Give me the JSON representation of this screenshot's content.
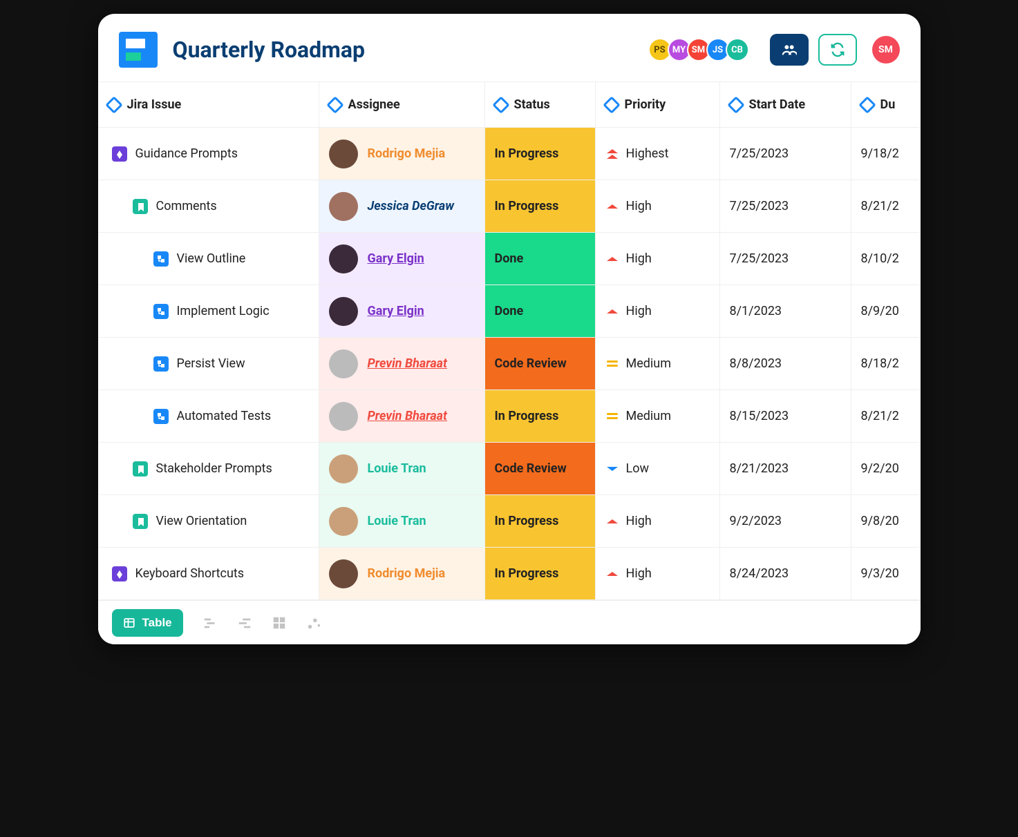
{
  "title": "Quarterly Roadmap",
  "presence": [
    "PS",
    "MY",
    "SM",
    "JS",
    "CB"
  ],
  "currentUser": "SM",
  "columns": {
    "issue": "Jira Issue",
    "assignee": "Assignee",
    "status": "Status",
    "priority": "Priority",
    "start": "Start Date",
    "due": "Du"
  },
  "footer": {
    "activeView": "Table"
  },
  "rows": [
    {
      "indent": 0,
      "type": "epic",
      "issue": "Guidance Prompts",
      "assignee": {
        "key": "rm",
        "name": "Rodrigo Mejia"
      },
      "status": {
        "key": "progress",
        "label": "In Progress"
      },
      "priority": {
        "key": "highest",
        "label": "Highest"
      },
      "start": "7/25/2023",
      "due": "9/18/2"
    },
    {
      "indent": 1,
      "type": "story",
      "issue": "Comments",
      "assignee": {
        "key": "jd",
        "name": "Jessica DeGraw"
      },
      "status": {
        "key": "progress",
        "label": "In Progress"
      },
      "priority": {
        "key": "high",
        "label": "High"
      },
      "start": "7/25/2023",
      "due": "8/21/2"
    },
    {
      "indent": 2,
      "type": "subtask",
      "issue": "View Outline",
      "assignee": {
        "key": "ge",
        "name": "Gary Elgin"
      },
      "status": {
        "key": "done",
        "label": "Done"
      },
      "priority": {
        "key": "high",
        "label": "High"
      },
      "start": "7/25/2023",
      "due": "8/10/2"
    },
    {
      "indent": 2,
      "type": "subtask",
      "issue": "Implement Logic",
      "assignee": {
        "key": "ge",
        "name": "Gary Elgin"
      },
      "status": {
        "key": "done",
        "label": "Done"
      },
      "priority": {
        "key": "high",
        "label": "High"
      },
      "start": "8/1/2023",
      "due": "8/9/20"
    },
    {
      "indent": 2,
      "type": "subtask",
      "issue": "Persist View",
      "assignee": {
        "key": "pb",
        "name": "Previn Bharaat"
      },
      "status": {
        "key": "review",
        "label": "Code Review"
      },
      "priority": {
        "key": "medium",
        "label": "Medium"
      },
      "start": "8/8/2023",
      "due": "8/18/2"
    },
    {
      "indent": 2,
      "type": "subtask",
      "issue": "Automated Tests",
      "assignee": {
        "key": "pb",
        "name": "Previn Bharaat"
      },
      "status": {
        "key": "progress",
        "label": "In Progress"
      },
      "priority": {
        "key": "medium",
        "label": "Medium"
      },
      "start": "8/15/2023",
      "due": "8/21/2"
    },
    {
      "indent": 1,
      "type": "story",
      "issue": "Stakeholder Prompts",
      "assignee": {
        "key": "lt",
        "name": "Louie Tran"
      },
      "status": {
        "key": "review",
        "label": "Code Review"
      },
      "priority": {
        "key": "low",
        "label": "Low"
      },
      "start": "8/21/2023",
      "due": "9/2/20"
    },
    {
      "indent": 1,
      "type": "story",
      "issue": "View Orientation",
      "assignee": {
        "key": "lt",
        "name": "Louie Tran"
      },
      "status": {
        "key": "progress",
        "label": "In Progress"
      },
      "priority": {
        "key": "high",
        "label": "High"
      },
      "start": "9/2/2023",
      "due": "9/8/20"
    },
    {
      "indent": 0,
      "type": "epic",
      "issue": "Keyboard Shortcuts",
      "assignee": {
        "key": "rm",
        "name": "Rodrigo Mejia"
      },
      "status": {
        "key": "progress",
        "label": "In Progress"
      },
      "priority": {
        "key": "high",
        "label": "High"
      },
      "start": "8/24/2023",
      "due": "9/3/20"
    }
  ]
}
